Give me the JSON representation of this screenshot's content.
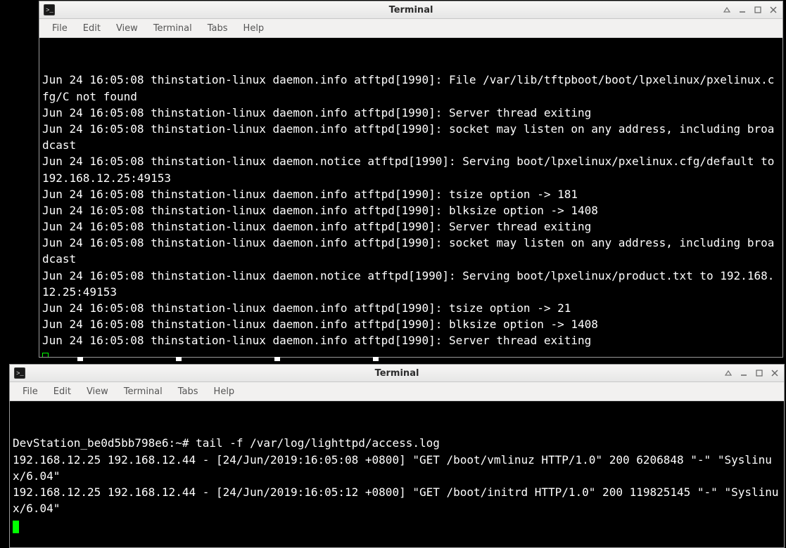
{
  "window1": {
    "title": "Terminal",
    "menus": {
      "file": "File",
      "edit": "Edit",
      "view": "View",
      "terminal": "Terminal",
      "tabs": "Tabs",
      "help": "Help"
    },
    "lines": [
      "Jun 24 16:05:08 thinstation-linux daemon.info atftpd[1990]: File /var/lib/tftpboot/boot/lpxelinux/pxelinux.cfg/C not found",
      "Jun 24 16:05:08 thinstation-linux daemon.info atftpd[1990]: Server thread exiting",
      "Jun 24 16:05:08 thinstation-linux daemon.info atftpd[1990]: socket may listen on any address, including broadcast",
      "Jun 24 16:05:08 thinstation-linux daemon.notice atftpd[1990]: Serving boot/lpxelinux/pxelinux.cfg/default to 192.168.12.25:49153",
      "Jun 24 16:05:08 thinstation-linux daemon.info atftpd[1990]: tsize option -> 181",
      "Jun 24 16:05:08 thinstation-linux daemon.info atftpd[1990]: blksize option -> 1408",
      "Jun 24 16:05:08 thinstation-linux daemon.info atftpd[1990]: Server thread exiting",
      "Jun 24 16:05:08 thinstation-linux daemon.info atftpd[1990]: socket may listen on any address, including broadcast",
      "Jun 24 16:05:08 thinstation-linux daemon.notice atftpd[1990]: Serving boot/lpxelinux/product.txt to 192.168.12.25:49153",
      "Jun 24 16:05:08 thinstation-linux daemon.info atftpd[1990]: tsize option -> 21",
      "Jun 24 16:05:08 thinstation-linux daemon.info atftpd[1990]: blksize option -> 1408",
      "Jun 24 16:05:08 thinstation-linux daemon.info atftpd[1990]: Server thread exiting"
    ]
  },
  "window2": {
    "title": "Terminal",
    "menus": {
      "file": "File",
      "edit": "Edit",
      "view": "View",
      "terminal": "Terminal",
      "tabs": "Tabs",
      "help": "Help"
    },
    "prompt_line": "DevStation_be0d5bb798e6:~# tail -f /var/log/lighttpd/access.log",
    "lines": [
      "192.168.12.25 192.168.12.44 - [24/Jun/2019:16:05:08 +0800] \"GET /boot/vmlinuz HTTP/1.0\" 200 6206848 \"-\" \"Syslinux/6.04\"",
      "192.168.12.25 192.168.12.44 - [24/Jun/2019:16:05:12 +0800] \"GET /boot/initrd HTTP/1.0\" 200 119825145 \"-\" \"Syslinux/6.04\""
    ]
  }
}
